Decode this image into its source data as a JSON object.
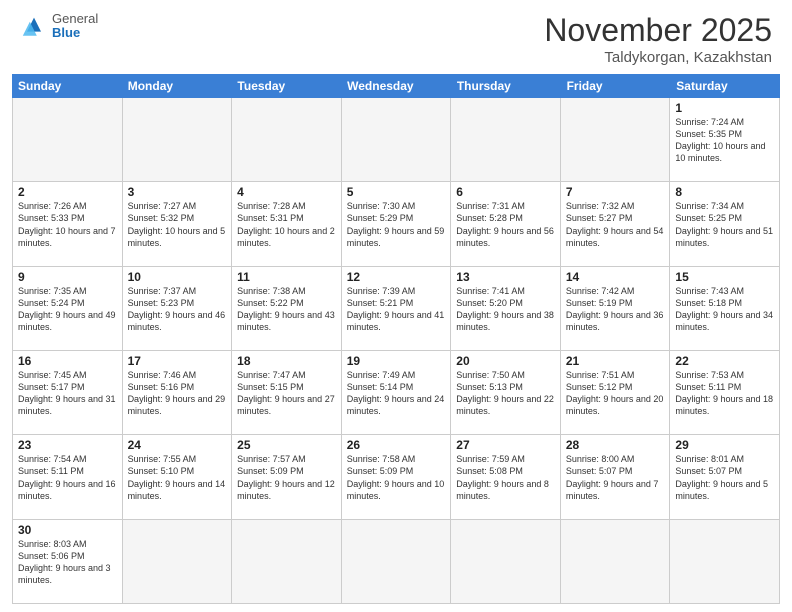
{
  "header": {
    "logo_general": "General",
    "logo_blue": "Blue",
    "month_title": "November 2025",
    "location": "Taldykorgan, Kazakhstan"
  },
  "day_headers": [
    "Sunday",
    "Monday",
    "Tuesday",
    "Wednesday",
    "Thursday",
    "Friday",
    "Saturday"
  ],
  "weeks": [
    [
      {
        "num": "",
        "info": "",
        "empty": true
      },
      {
        "num": "",
        "info": "",
        "empty": true
      },
      {
        "num": "",
        "info": "",
        "empty": true
      },
      {
        "num": "",
        "info": "",
        "empty": true
      },
      {
        "num": "",
        "info": "",
        "empty": true
      },
      {
        "num": "",
        "info": "",
        "empty": true
      },
      {
        "num": "1",
        "info": "Sunrise: 7:24 AM\nSunset: 5:35 PM\nDaylight: 10 hours\nand 10 minutes.",
        "empty": false
      }
    ],
    [
      {
        "num": "2",
        "info": "Sunrise: 7:26 AM\nSunset: 5:33 PM\nDaylight: 10 hours\nand 7 minutes.",
        "empty": false
      },
      {
        "num": "3",
        "info": "Sunrise: 7:27 AM\nSunset: 5:32 PM\nDaylight: 10 hours\nand 5 minutes.",
        "empty": false
      },
      {
        "num": "4",
        "info": "Sunrise: 7:28 AM\nSunset: 5:31 PM\nDaylight: 10 hours\nand 2 minutes.",
        "empty": false
      },
      {
        "num": "5",
        "info": "Sunrise: 7:30 AM\nSunset: 5:29 PM\nDaylight: 9 hours\nand 59 minutes.",
        "empty": false
      },
      {
        "num": "6",
        "info": "Sunrise: 7:31 AM\nSunset: 5:28 PM\nDaylight: 9 hours\nand 56 minutes.",
        "empty": false
      },
      {
        "num": "7",
        "info": "Sunrise: 7:32 AM\nSunset: 5:27 PM\nDaylight: 9 hours\nand 54 minutes.",
        "empty": false
      },
      {
        "num": "8",
        "info": "Sunrise: 7:34 AM\nSunset: 5:25 PM\nDaylight: 9 hours\nand 51 minutes.",
        "empty": false
      }
    ],
    [
      {
        "num": "9",
        "info": "Sunrise: 7:35 AM\nSunset: 5:24 PM\nDaylight: 9 hours\nand 49 minutes.",
        "empty": false
      },
      {
        "num": "10",
        "info": "Sunrise: 7:37 AM\nSunset: 5:23 PM\nDaylight: 9 hours\nand 46 minutes.",
        "empty": false
      },
      {
        "num": "11",
        "info": "Sunrise: 7:38 AM\nSunset: 5:22 PM\nDaylight: 9 hours\nand 43 minutes.",
        "empty": false
      },
      {
        "num": "12",
        "info": "Sunrise: 7:39 AM\nSunset: 5:21 PM\nDaylight: 9 hours\nand 41 minutes.",
        "empty": false
      },
      {
        "num": "13",
        "info": "Sunrise: 7:41 AM\nSunset: 5:20 PM\nDaylight: 9 hours\nand 38 minutes.",
        "empty": false
      },
      {
        "num": "14",
        "info": "Sunrise: 7:42 AM\nSunset: 5:19 PM\nDaylight: 9 hours\nand 36 minutes.",
        "empty": false
      },
      {
        "num": "15",
        "info": "Sunrise: 7:43 AM\nSunset: 5:18 PM\nDaylight: 9 hours\nand 34 minutes.",
        "empty": false
      }
    ],
    [
      {
        "num": "16",
        "info": "Sunrise: 7:45 AM\nSunset: 5:17 PM\nDaylight: 9 hours\nand 31 minutes.",
        "empty": false
      },
      {
        "num": "17",
        "info": "Sunrise: 7:46 AM\nSunset: 5:16 PM\nDaylight: 9 hours\nand 29 minutes.",
        "empty": false
      },
      {
        "num": "18",
        "info": "Sunrise: 7:47 AM\nSunset: 5:15 PM\nDaylight: 9 hours\nand 27 minutes.",
        "empty": false
      },
      {
        "num": "19",
        "info": "Sunrise: 7:49 AM\nSunset: 5:14 PM\nDaylight: 9 hours\nand 24 minutes.",
        "empty": false
      },
      {
        "num": "20",
        "info": "Sunrise: 7:50 AM\nSunset: 5:13 PM\nDaylight: 9 hours\nand 22 minutes.",
        "empty": false
      },
      {
        "num": "21",
        "info": "Sunrise: 7:51 AM\nSunset: 5:12 PM\nDaylight: 9 hours\nand 20 minutes.",
        "empty": false
      },
      {
        "num": "22",
        "info": "Sunrise: 7:53 AM\nSunset: 5:11 PM\nDaylight: 9 hours\nand 18 minutes.",
        "empty": false
      }
    ],
    [
      {
        "num": "23",
        "info": "Sunrise: 7:54 AM\nSunset: 5:11 PM\nDaylight: 9 hours\nand 16 minutes.",
        "empty": false
      },
      {
        "num": "24",
        "info": "Sunrise: 7:55 AM\nSunset: 5:10 PM\nDaylight: 9 hours\nand 14 minutes.",
        "empty": false
      },
      {
        "num": "25",
        "info": "Sunrise: 7:57 AM\nSunset: 5:09 PM\nDaylight: 9 hours\nand 12 minutes.",
        "empty": false
      },
      {
        "num": "26",
        "info": "Sunrise: 7:58 AM\nSunset: 5:09 PM\nDaylight: 9 hours\nand 10 minutes.",
        "empty": false
      },
      {
        "num": "27",
        "info": "Sunrise: 7:59 AM\nSunset: 5:08 PM\nDaylight: 9 hours\nand 8 minutes.",
        "empty": false
      },
      {
        "num": "28",
        "info": "Sunrise: 8:00 AM\nSunset: 5:07 PM\nDaylight: 9 hours\nand 7 minutes.",
        "empty": false
      },
      {
        "num": "29",
        "info": "Sunrise: 8:01 AM\nSunset: 5:07 PM\nDaylight: 9 hours\nand 5 minutes.",
        "empty": false
      }
    ],
    [
      {
        "num": "30",
        "info": "Sunrise: 8:03 AM\nSunset: 5:06 PM\nDaylight: 9 hours\nand 3 minutes.",
        "empty": false
      },
      {
        "num": "",
        "info": "",
        "empty": true
      },
      {
        "num": "",
        "info": "",
        "empty": true
      },
      {
        "num": "",
        "info": "",
        "empty": true
      },
      {
        "num": "",
        "info": "",
        "empty": true
      },
      {
        "num": "",
        "info": "",
        "empty": true
      },
      {
        "num": "",
        "info": "",
        "empty": true
      }
    ]
  ]
}
